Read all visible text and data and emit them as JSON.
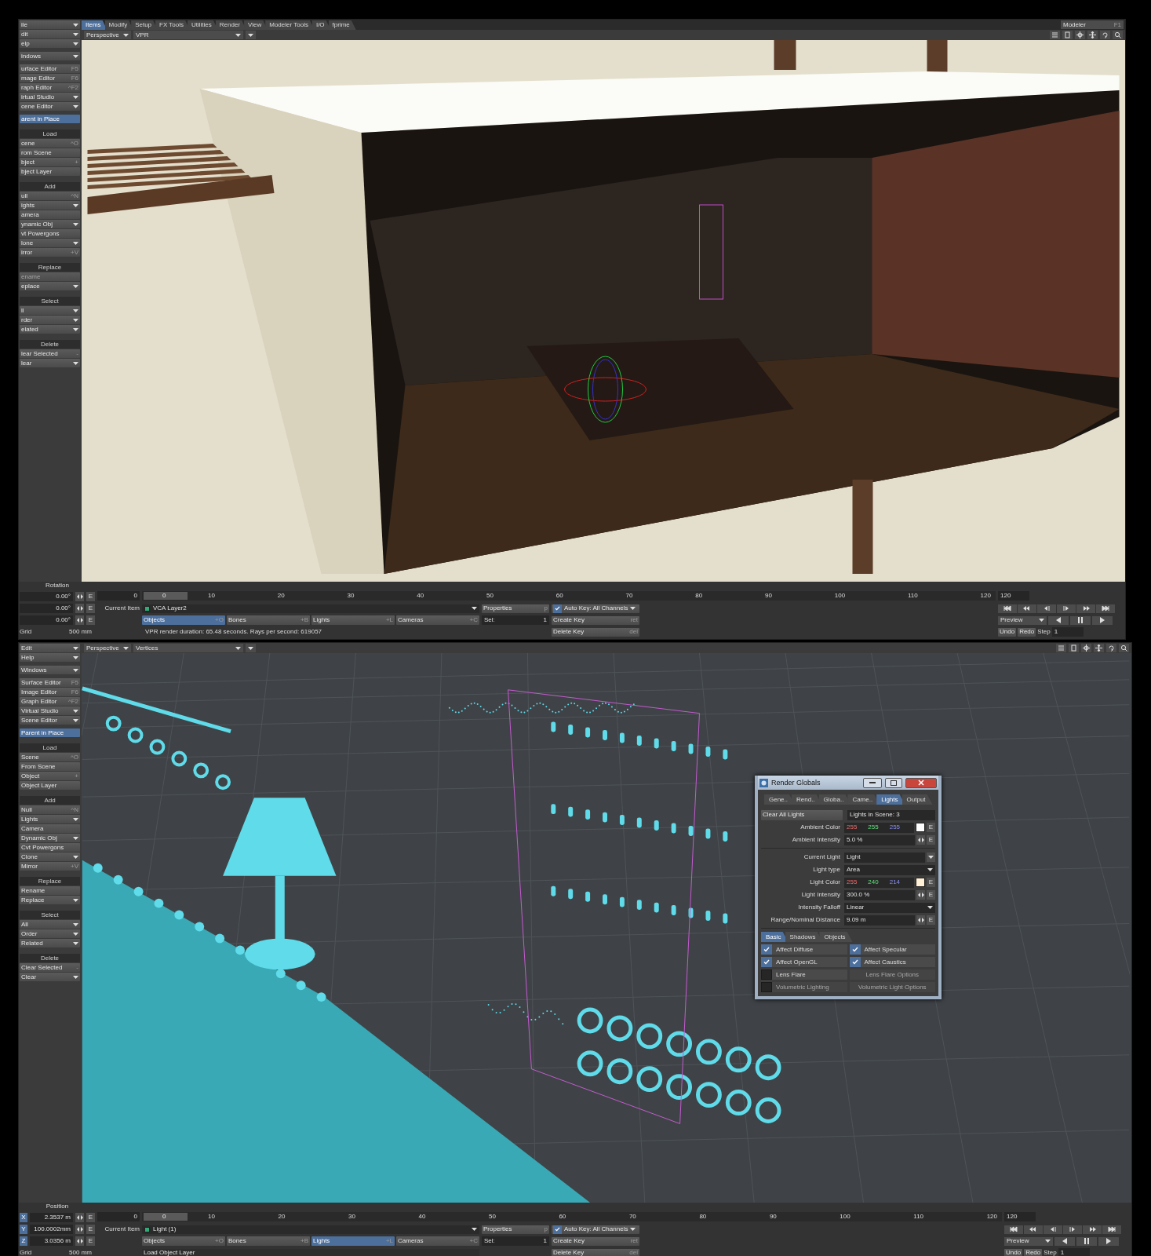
{
  "windows": [
    {
      "menu_tabs": [
        {
          "label": "Items",
          "selected": true
        },
        {
          "label": "Modify",
          "selected": false
        },
        {
          "label": "Setup",
          "selected": false
        },
        {
          "label": "FX Tools",
          "selected": false
        },
        {
          "label": "Utilities",
          "selected": false
        },
        {
          "label": "Render",
          "selected": false
        },
        {
          "label": "View",
          "selected": false
        },
        {
          "label": "Modeler Tools",
          "selected": false
        },
        {
          "label": "I/O",
          "selected": false
        },
        {
          "label": "fprime",
          "selected": false
        }
      ],
      "switch": {
        "label": "Modeler",
        "shortcut": "F1"
      },
      "view_header": {
        "view": "Perspective",
        "mode": "VPR"
      },
      "sidebar": [
        {
          "items": [
            {
              "kind": "menu",
              "label": "ile",
              "disabled": false
            },
            {
              "kind": "menu",
              "label": "dit",
              "disabled": false
            },
            {
              "kind": "menu",
              "label": "elp",
              "disabled": false
            }
          ]
        },
        {
          "items": [
            {
              "kind": "menu",
              "label": "indows",
              "disabled": false
            }
          ]
        },
        {
          "items": [
            {
              "kind": "button",
              "label": "urface Editor",
              "shortcut": "F5",
              "disabled": false
            },
            {
              "kind": "button",
              "label": "mage Editor",
              "shortcut": "F6",
              "disabled": false
            },
            {
              "kind": "button",
              "label": "raph Editor",
              "shortcut": "^F2",
              "disabled": false
            },
            {
              "kind": "menu",
              "label": "irtual Studio",
              "disabled": false
            },
            {
              "kind": "menu",
              "label": "cene Editor",
              "disabled": false
            }
          ]
        },
        {
          "items": [
            {
              "kind": "toggle",
              "label": "arent in Place",
              "on": true
            }
          ]
        },
        {
          "header": "Load",
          "items": [
            {
              "kind": "button",
              "label": "cene",
              "shortcut": "^O",
              "disabled": false
            },
            {
              "kind": "button",
              "label": "rom Scene",
              "disabled": false
            },
            {
              "kind": "button",
              "label": "bject",
              "shortcut": "+",
              "disabled": false
            },
            {
              "kind": "button",
              "label": "bject Layer",
              "disabled": false
            }
          ]
        },
        {
          "header": "Add",
          "items": [
            {
              "kind": "button",
              "label": "ull",
              "shortcut": "^N",
              "disabled": false
            },
            {
              "kind": "menu",
              "label": "ights",
              "disabled": false
            },
            {
              "kind": "button",
              "label": "amera",
              "disabled": false
            },
            {
              "kind": "menu",
              "label": "ynamic Obj",
              "disabled": false
            },
            {
              "kind": "button",
              "label": "vt Powergons",
              "disabled": false
            },
            {
              "kind": "menu",
              "label": "lone",
              "disabled": false
            },
            {
              "kind": "button",
              "label": "irror",
              "shortcut": "+V",
              "disabled": false
            }
          ]
        },
        {
          "header": "Replace",
          "items": [
            {
              "kind": "button",
              "label": "ename",
              "disabled": true
            },
            {
              "kind": "menu",
              "label": "eplace",
              "disabled": false
            }
          ]
        },
        {
          "header": "Select",
          "items": [
            {
              "kind": "menu",
              "label": "ll",
              "disabled": false
            },
            {
              "kind": "menu",
              "label": "rder",
              "disabled": false
            },
            {
              "kind": "menu",
              "label": "elated",
              "disabled": false
            }
          ]
        },
        {
          "header": "Delete",
          "items": [
            {
              "kind": "button",
              "label": "lear Selected",
              "shortcut": "-",
              "disabled": false
            },
            {
              "kind": "menu",
              "label": "lear",
              "disabled": false
            }
          ]
        }
      ],
      "viewport": {
        "kind": "render"
      },
      "controls": {
        "channel": "Rotation",
        "axes": [
          {
            "value": "0.00°",
            "envelope": "E"
          },
          {
            "value": "0.00°",
            "envelope": "E"
          },
          {
            "value": "0.00°",
            "envelope": "E"
          }
        ],
        "frame": "0",
        "timeline": {
          "current": "0",
          "ticks": [
            "10",
            "20",
            "30",
            "40",
            "50",
            "60",
            "70",
            "80",
            "90",
            "100",
            "110",
            "120"
          ]
        },
        "end_frame": "120",
        "current_item_label": "Current Item",
        "current_item": "VCA Layer2",
        "properties": {
          "label": "Properties",
          "shortcut": "p"
        },
        "auto_key": {
          "label": "Auto Key: All Channels",
          "checked": true
        },
        "item_types": [
          {
            "label": "Objects",
            "shortcut": "+O",
            "selected": true
          },
          {
            "label": "Bones",
            "shortcut": "+B",
            "selected": false
          },
          {
            "label": "Lights",
            "shortcut": "+L",
            "selected": false
          },
          {
            "label": "Cameras",
            "shortcut": "+C",
            "selected": false
          }
        ],
        "sel": {
          "label": "Sel:",
          "value": "1"
        },
        "create_key": {
          "label": "Create Key",
          "shortcut": "ret"
        },
        "grid": {
          "label": "Grid",
          "value": "500 mm"
        },
        "status": {
          "kind": "message",
          "text": "VPR render duration: 65.48 seconds. Rays per second: 619057"
        },
        "delete_key": {
          "label": "Delete Key",
          "shortcut": "del"
        },
        "preview": "Preview",
        "undo": "Undo",
        "redo": "Redo",
        "step": {
          "label": "Step",
          "value": "1"
        }
      }
    },
    {
      "view_header": {
        "view": "Perspective",
        "mode": "Vertices"
      },
      "sidebar": [
        {
          "items": [
            {
              "kind": "menu",
              "label": "Edit",
              "disabled": false
            },
            {
              "kind": "menu",
              "label": "Help",
              "disabled": false
            }
          ]
        },
        {
          "items": [
            {
              "kind": "menu",
              "label": "Windows",
              "disabled": false
            }
          ]
        },
        {
          "items": [
            {
              "kind": "button",
              "label": "Surface Editor",
              "shortcut": "F5",
              "disabled": false
            },
            {
              "kind": "button",
              "label": "Image Editor",
              "shortcut": "F6",
              "disabled": false
            },
            {
              "kind": "button",
              "label": "Graph Editor",
              "shortcut": "^F2",
              "disabled": false
            },
            {
              "kind": "menu",
              "label": "Virtual Studio",
              "disabled": false
            },
            {
              "kind": "menu",
              "label": "Scene Editor",
              "disabled": false
            }
          ]
        },
        {
          "items": [
            {
              "kind": "toggle",
              "label": "Parent in Place",
              "on": true
            }
          ]
        },
        {
          "header": "Load",
          "items": [
            {
              "kind": "button",
              "label": "Scene",
              "shortcut": "^O",
              "disabled": false
            },
            {
              "kind": "button",
              "label": "From Scene",
              "disabled": false
            },
            {
              "kind": "button",
              "label": "Object",
              "shortcut": "+",
              "disabled": false
            },
            {
              "kind": "button",
              "label": "Object Layer",
              "disabled": false
            }
          ]
        },
        {
          "header": "Add",
          "items": [
            {
              "kind": "button",
              "label": "Null",
              "shortcut": "^N",
              "disabled": false
            },
            {
              "kind": "menu",
              "label": "Lights",
              "disabled": false
            },
            {
              "kind": "button",
              "label": "Camera",
              "disabled": false
            },
            {
              "kind": "menu",
              "label": "Dynamic Obj",
              "disabled": false
            },
            {
              "kind": "button",
              "label": "Cvt Powergons",
              "disabled": false
            },
            {
              "kind": "menu",
              "label": "Clone",
              "disabled": false
            },
            {
              "kind": "button",
              "label": "Mirror",
              "shortcut": "+V",
              "disabled": false
            }
          ]
        },
        {
          "header": "Replace",
          "items": [
            {
              "kind": "button",
              "label": "Rename",
              "disabled": false
            },
            {
              "kind": "menu",
              "label": "Replace",
              "disabled": false
            }
          ]
        },
        {
          "header": "Select",
          "items": [
            {
              "kind": "menu",
              "label": "All",
              "disabled": false
            },
            {
              "kind": "menu",
              "label": "Order",
              "disabled": false
            },
            {
              "kind": "menu",
              "label": "Related",
              "disabled": false
            }
          ]
        },
        {
          "header": "Delete",
          "items": [
            {
              "kind": "button",
              "label": "Clear Selected",
              "shortcut": "-",
              "disabled": false
            },
            {
              "kind": "menu",
              "label": "Clear",
              "disabled": false
            }
          ]
        }
      ],
      "viewport": {
        "kind": "points",
        "dialog": {
          "title": "Render Globals",
          "tabs": [
            {
              "label": "Gene..",
              "selected": false
            },
            {
              "label": "Rend..",
              "selected": false
            },
            {
              "label": "Globa..",
              "selected": false
            },
            {
              "label": "Came..",
              "selected": false
            },
            {
              "label": "Lights",
              "selected": true
            },
            {
              "label": "Output",
              "selected": false
            }
          ],
          "clear_button": "Clear All Lights",
          "lights_count": "Lights in Scene: 3",
          "groups": [
            {
              "rows": [
                {
                  "kind": "color",
                  "label": "Ambient Color",
                  "rgb": [
                    "255",
                    "255",
                    "255"
                  ],
                  "color": "#ffffff",
                  "envelope": "E"
                },
                {
                  "kind": "number",
                  "label": "Ambient Intensity",
                  "value": "5.0 %",
                  "envelope": "E"
                }
              ]
            },
            {
              "rows": [
                {
                  "kind": "picker",
                  "label": "Current Light",
                  "value": "Light"
                },
                {
                  "kind": "select",
                  "label": "Light type",
                  "value": "Area"
                },
                {
                  "kind": "color",
                  "label": "Light Color",
                  "rgb": [
                    "255",
                    "240",
                    "214"
                  ],
                  "color": "#fff0d6",
                  "envelope": "E"
                },
                {
                  "kind": "number",
                  "label": "Light Intensity",
                  "value": "300.0 %",
                  "envelope": "E"
                },
                {
                  "kind": "select",
                  "label": "Intensity Falloff",
                  "value": "Linear"
                },
                {
                  "kind": "number",
                  "label": "Range/Nominal Distance",
                  "value": "9.09 m",
                  "envelope": "E"
                }
              ]
            }
          ],
          "subtabs": [
            {
              "label": "Basic",
              "selected": true
            },
            {
              "label": "Shadows",
              "selected": false
            },
            {
              "label": "Objects",
              "selected": false
            }
          ],
          "options": [
            {
              "kind": "check",
              "label": "Affect Diffuse",
              "checked": true,
              "disabled": false
            },
            {
              "kind": "check",
              "label": "Affect Specular",
              "checked": true,
              "disabled": false
            },
            {
              "kind": "check",
              "label": "Affect OpenGL",
              "checked": true,
              "disabled": false
            },
            {
              "kind": "check",
              "label": "Affect Caustics",
              "checked": true,
              "disabled": false
            },
            {
              "kind": "check",
              "label": "Lens Flare",
              "checked": false,
              "disabled": false
            },
            {
              "kind": "action",
              "label": "Lens Flare Options",
              "disabled": true
            },
            {
              "kind": "check",
              "label": "Volumetric Lighting",
              "checked": false,
              "disabled": true
            },
            {
              "kind": "action",
              "label": "Volumetric Light Options",
              "disabled": true
            }
          ]
        }
      },
      "controls": {
        "channel": "Position",
        "axes": [
          {
            "axis": "X",
            "value": "2.3537 m",
            "envelope": "E"
          },
          {
            "axis": "Y",
            "value": "100.0002mm",
            "envelope": "E"
          },
          {
            "axis": "Z",
            "value": "3.0356 m",
            "envelope": "E"
          }
        ],
        "frame": "0",
        "timeline": {
          "current": "0",
          "ticks": [
            "10",
            "20",
            "30",
            "40",
            "50",
            "60",
            "70",
            "80",
            "90",
            "100",
            "110",
            "120"
          ]
        },
        "end_frame": "120",
        "current_item_label": "Current Item",
        "current_item": "Light (1)",
        "properties": {
          "label": "Properties",
          "shortcut": "p"
        },
        "auto_key": {
          "label": "Auto Key: All Channels",
          "checked": true
        },
        "item_types": [
          {
            "label": "Objects",
            "shortcut": "+O",
            "selected": false
          },
          {
            "label": "Bones",
            "shortcut": "+B",
            "selected": false
          },
          {
            "label": "Lights",
            "shortcut": "+L",
            "selected": true
          },
          {
            "label": "Cameras",
            "shortcut": "+C",
            "selected": false
          }
        ],
        "sel": {
          "label": "Sel:",
          "value": "1"
        },
        "create_key": {
          "label": "Create Key",
          "shortcut": "ret"
        },
        "grid": {
          "label": "Grid",
          "value": "500 mm"
        },
        "status": {
          "kind": "button",
          "text": "Load Object Layer"
        },
        "delete_key": {
          "label": "Delete Key",
          "shortcut": "del"
        },
        "preview": "Preview",
        "undo": "Undo",
        "redo": "Redo",
        "step": {
          "label": "Step",
          "value": "1"
        }
      }
    }
  ]
}
